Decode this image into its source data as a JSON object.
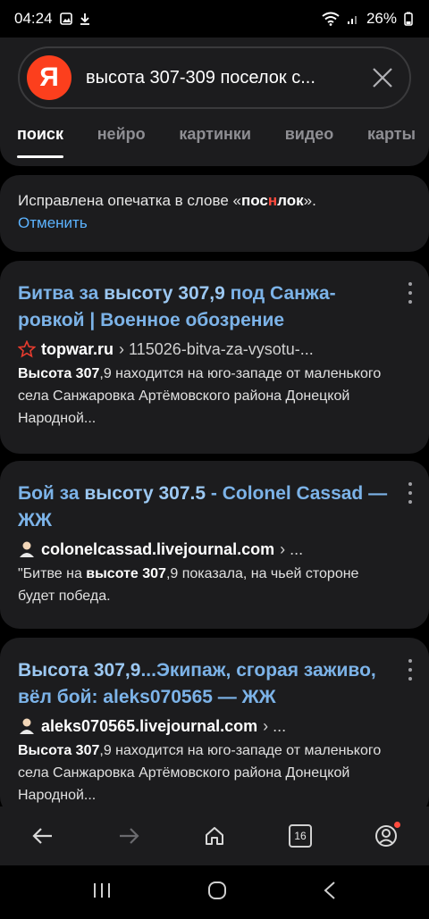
{
  "status_bar": {
    "time": "04:24",
    "battery": "26%"
  },
  "search": {
    "logo": "Я",
    "query": "высота 307-309 поселок с..."
  },
  "tabs": [
    {
      "label": "поиск",
      "active": true
    },
    {
      "label": "нейро",
      "active": false
    },
    {
      "label": "картинки",
      "active": false
    },
    {
      "label": "видео",
      "active": false
    },
    {
      "label": "карты",
      "active": false
    }
  ],
  "typo_notice": {
    "prefix": "Исправлена опечатка в слове «",
    "word_a": "пос",
    "word_hl": "н",
    "word_b": "лок",
    "suffix": "».",
    "cancel": "Отменить"
  },
  "results": [
    {
      "title_pre": "Битва за ",
      "title_bold": "высоту 307,9",
      "title_post": " под Санжа­ровкой | Военное обозрение",
      "domain": "topwar.ru",
      "path": "› 115026-bitva-za-vysotu-...",
      "icon": "star-icon",
      "snippet_bold": "Высота 307",
      "snippet_rest": ",9 находится на юго-западе от ма­ленького села Санжаровка Артёмовского рай­она Донецкой Народной..."
    },
    {
      "title_pre": "Бой за ",
      "title_bold": "высоту 307.5",
      "title_post": " - Colonel Cassad — ЖЖ",
      "domain": "colonelcassad.livejournal.com",
      "path": "› ...",
      "icon": "user-icon",
      "snippet_pre": "\"Битве на ",
      "snippet_bold": "высоте 307",
      "snippet_rest": ",9 показала, на чьей сто­роне будет победа."
    },
    {
      "title_pre": "",
      "title_bold": "Высота 307,9",
      "title_post": "...Экипаж, сгорая за­живо, вёл бой: aleks070565 — ЖЖ",
      "domain": "aleks070565.livejournal.com",
      "path": "› ...",
      "icon": "user-icon",
      "snippet_bold": "Высота 307",
      "snippet_rest": ",9 находится на юго-западе от ма­ленького села Санжаровка Артёмовского рай­она Донецкой Народной..."
    }
  ],
  "browser_bar": {
    "tabs_count": "16"
  },
  "colors": {
    "accent_link": "#7cb3e8",
    "yandex_red": "#fc3f1d",
    "highlight": "#ff4b3e"
  }
}
